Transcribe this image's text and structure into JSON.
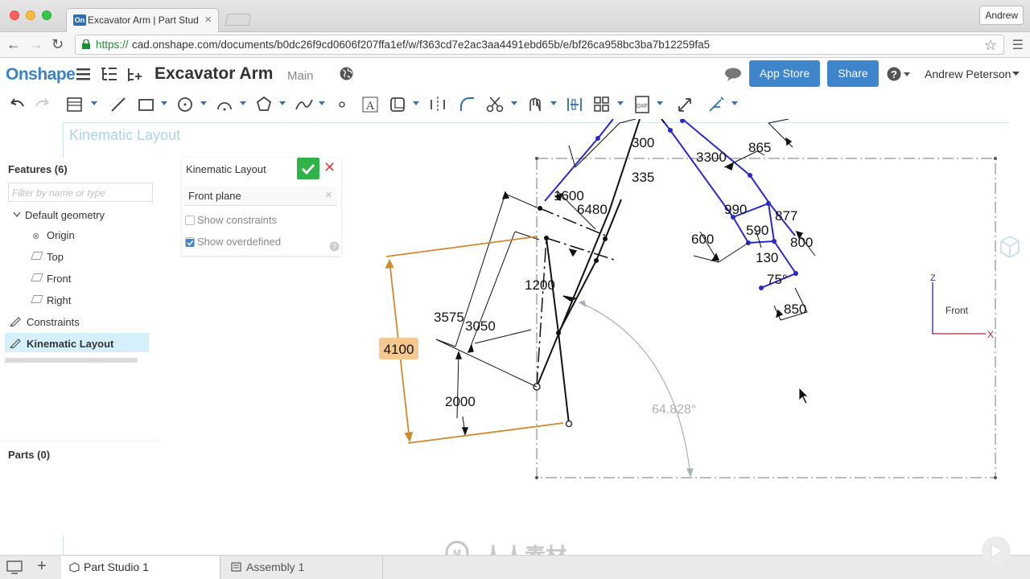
{
  "browser": {
    "tab_title": "Excavator Arm | Part Stud",
    "tab_favicon": "On",
    "profile_name": "Andrew",
    "url_scheme": "https://",
    "url_rest": "cad.onshape.com/documents/b0dc26f9cd0606f207ffa1ef/w/f363cd7e2ac3aa4491ebd65b/e/bf26ca958bc3ba7b12259fa5"
  },
  "header": {
    "logo": "Onshape",
    "document_title": "Excavator Arm",
    "branch": "Main",
    "app_store_label": "App Store",
    "share_label": "Share",
    "user_name": "Andrew Peterson"
  },
  "sketch": {
    "name": "Kinematic Layout",
    "dimensions": {
      "d300": "300",
      "d335": "335",
      "d3300": "3300",
      "d865": "865",
      "d1600": "1600",
      "d6480": "6480",
      "d990": "990",
      "d877": "877",
      "d600": "600",
      "d590": "590",
      "d800": "800",
      "d130": "130",
      "d75": "75°",
      "d850": "850",
      "d1200": "1200",
      "d3575": "3575",
      "d3050": "3050",
      "d4100": "4100",
      "d2000": "2000",
      "angle": "64.828°"
    }
  },
  "view_cube": {
    "label": "Front",
    "z_axis": "Z",
    "x_axis": "X"
  },
  "feature_list": {
    "header": "Features (6)",
    "filter_placeholder": "Filter by name or type",
    "items": [
      {
        "label": "Default geometry"
      },
      {
        "label": "Origin"
      },
      {
        "label": "Top"
      },
      {
        "label": "Front"
      },
      {
        "label": "Right"
      },
      {
        "label": "Constraints"
      },
      {
        "label": "Kinematic Layout"
      }
    ],
    "parts_header": "Parts (0)"
  },
  "dialog": {
    "title": "Kinematic Layout",
    "plane": "Front plane",
    "show_constraints": "Show constraints",
    "show_overdefined": "Show overdefined",
    "show_constraints_checked": false,
    "show_overdefined_checked": true
  },
  "bottom_tabs": [
    {
      "label": "Part Studio 1"
    },
    {
      "label": "Assembly 1"
    }
  ],
  "watermark": "人人素材",
  "colors": {
    "accent": "#3f85cc",
    "sketch_blue": "#2828c8",
    "dimension_orange": "#cf8a2e",
    "confirm_green": "#2fb348",
    "cancel_red": "#e0413b"
  }
}
